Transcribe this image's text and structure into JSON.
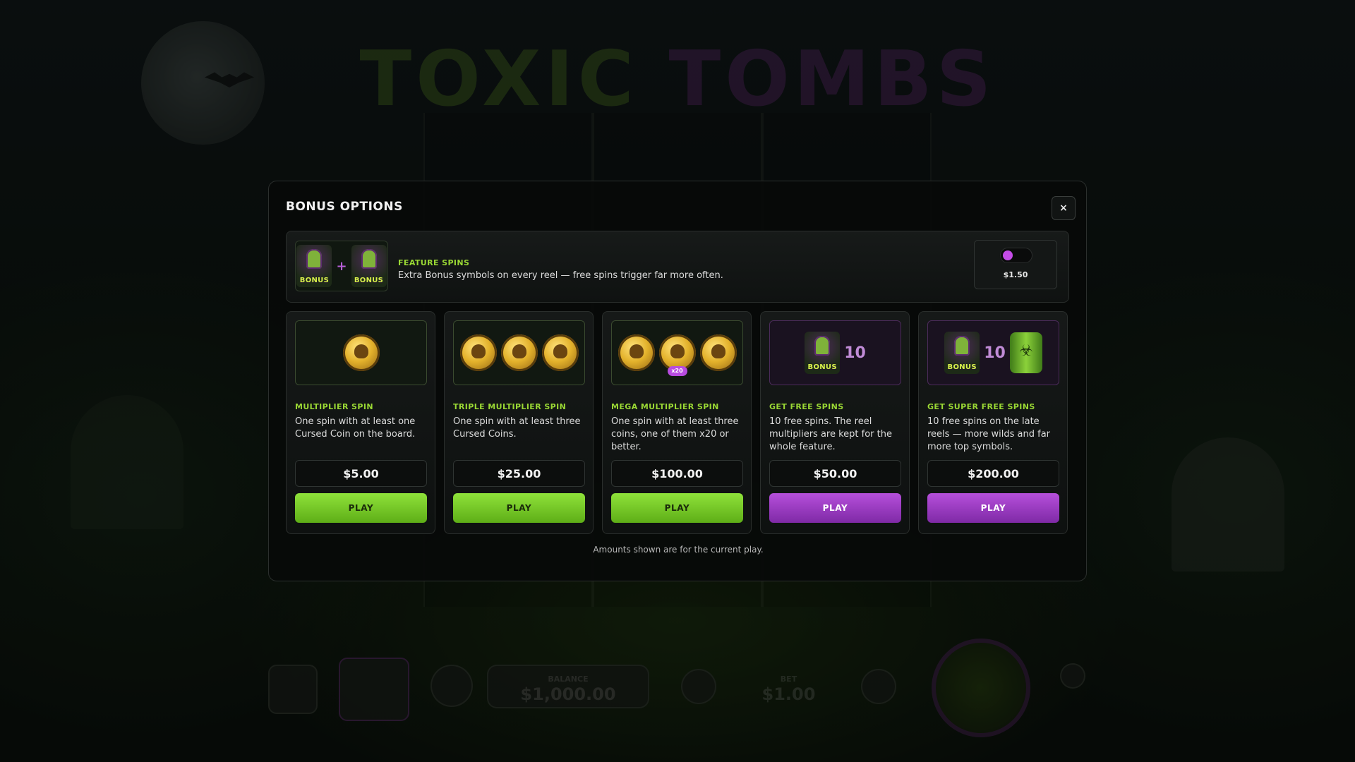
{
  "background": {
    "logo_word1": "TOXIC",
    "logo_word2": "TOMBS",
    "balance_label": "BALANCE",
    "balance_value": "$1,000.00",
    "bet_label": "BET",
    "bet_value": "$1.00"
  },
  "modal": {
    "title": "Bonus Options",
    "close_label": "×",
    "footnote": "Amounts shown are for the current play."
  },
  "feature": {
    "name": "Feature Spins",
    "description": "Extra Bonus symbols on every reel — free spins trigger far more often.",
    "price": "$1.50",
    "enabled": false,
    "bonus_label": "BONUS",
    "plus": "+"
  },
  "options": [
    {
      "title": "Multiplier Spin",
      "description": "One spin with at least one Cursed Coin on the board.",
      "price": "$5.00",
      "play_label": "PLAY",
      "button_color": "#6fc024"
    },
    {
      "title": "Triple Multiplier Spin",
      "description": "One spin with at least three Cursed Coins.",
      "price": "$25.00",
      "play_label": "PLAY",
      "button_color": "#6fc024"
    },
    {
      "title": "Mega Multiplier Spin",
      "description": "One spin with at least three coins, one of them x20 or better.",
      "price": "$100.00",
      "play_label": "PLAY",
      "button_color": "#6fc024",
      "coin_tag": "x20"
    },
    {
      "title": "Get Free Spins",
      "description": "10 free spins. The reel multipliers are kept for the whole feature.",
      "price": "$50.00",
      "play_label": "PLAY",
      "button_color": "#9a3cc4",
      "spin_count": "10"
    },
    {
      "title": "Get Super Free Spins",
      "description": "10 free spins on the late reels — more wilds and far more top symbols.",
      "price": "$200.00",
      "play_label": "PLAY",
      "button_color": "#9a3cc4",
      "spin_count": "10"
    }
  ],
  "colors": {
    "accent_green": "#9ad834",
    "accent_purple": "#c54ce8",
    "modal_bg": "#080a09"
  }
}
